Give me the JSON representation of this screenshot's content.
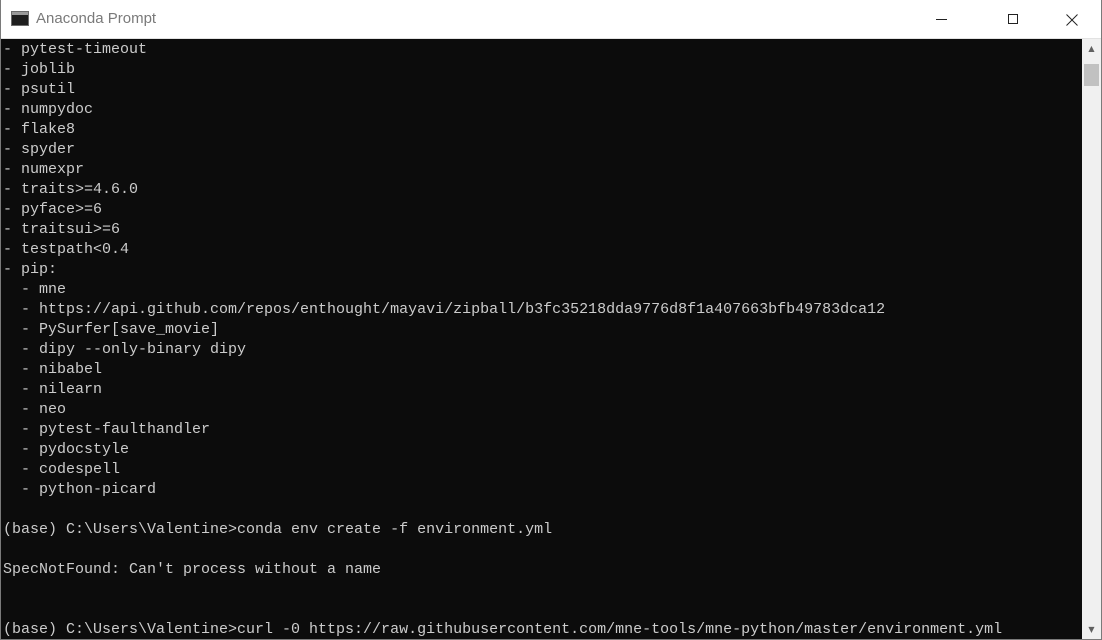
{
  "window": {
    "title": "Anaconda Prompt",
    "icon": "console-icon",
    "controls": {
      "minimize": "minimize-icon",
      "maximize": "maximize-icon",
      "close": "close-icon"
    }
  },
  "console": {
    "foreground": "#cccccc",
    "background": "#0c0c0c",
    "lines": [
      "- pytest-timeout",
      "- joblib",
      "- psutil",
      "- numpydoc",
      "- flake8",
      "- spyder",
      "- numexpr",
      "- traits>=4.6.0",
      "- pyface>=6",
      "- traitsui>=6",
      "- testpath<0.4",
      "- pip:",
      "  - mne",
      "  - https://api.github.com/repos/enthought/mayavi/zipball/b3fc35218dda9776d8f1a407663bfb49783dca12",
      "  - PySurfer[save_movie]",
      "  - dipy --only-binary dipy",
      "  - nibabel",
      "  - nilearn",
      "  - neo",
      "  - pytest-faulthandler",
      "  - pydocstyle",
      "  - codespell",
      "  - python-picard",
      "",
      "(base) C:\\Users\\Valentine>conda env create -f environment.yml",
      "",
      "SpecNotFound: Can't process without a name",
      "",
      "",
      "(base) C:\\Users\\Valentine>curl -0 https://raw.githubusercontent.com/mne-tools/mne-python/master/environment.yml"
    ]
  },
  "scrollbar": {
    "up_icon": "scroll-up-arrow-icon",
    "down_icon": "scroll-down-arrow-icon"
  }
}
